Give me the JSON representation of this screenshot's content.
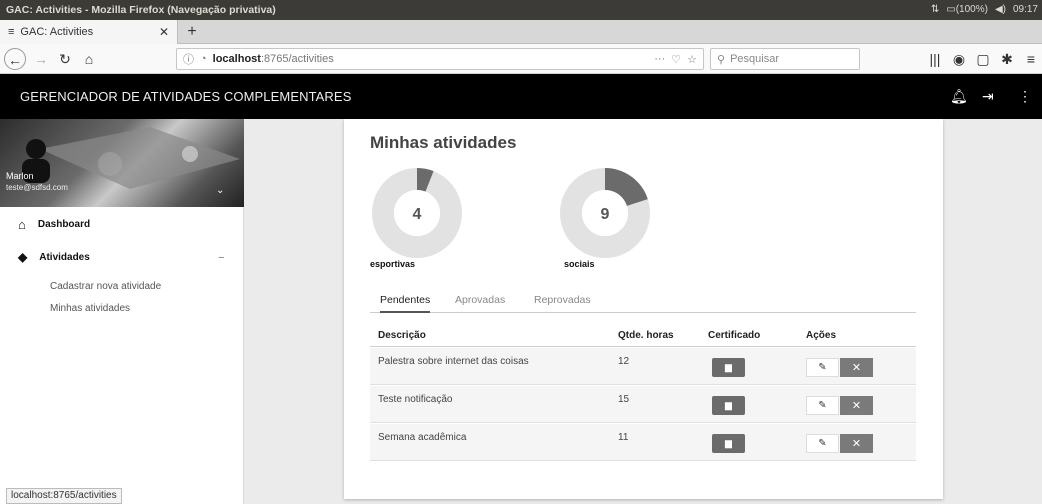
{
  "window": {
    "title": "GAC: Activities - Mozilla Firefox (Navegação privativa)",
    "tray": {
      "battery": "(100%)",
      "time": "09:17"
    }
  },
  "browser": {
    "tab_title": "GAC: Activities",
    "url_host": "localhost",
    "url_path": ":8765/activities",
    "search_placeholder": "Pesquisar",
    "page_actions": "···",
    "status_url": "localhost:8765/activities"
  },
  "app": {
    "name": "GERENCIADOR DE ATIVIDADES COMPLEMENTARES"
  },
  "user": {
    "name": "Marlon",
    "email": "teste@sdfsd.com"
  },
  "sidebar": {
    "dashboard": "Dashboard",
    "atividades": "Atividades",
    "collapse_symbol": "–",
    "sub": [
      "Cadastrar nova atividade",
      "Minhas atividades"
    ]
  },
  "main": {
    "title": "Minhas atividades",
    "charts": [
      {
        "label": "esportivas",
        "count": "4",
        "fraction": 0.06
      },
      {
        "label": "sociais",
        "count": "9",
        "fraction": 0.2
      }
    ],
    "tabs": [
      "Pendentes",
      "Aprovadas",
      "Reprovadas"
    ],
    "columns": [
      "Descrição",
      "Qtde. horas",
      "Certificado",
      "Ações"
    ],
    "rows": [
      {
        "descricao": "Palestra sobre internet das coisas",
        "horas": "12"
      },
      {
        "descricao": "Teste notificação",
        "horas": "15"
      },
      {
        "descricao": "Semana acadêmica",
        "horas": "11"
      }
    ]
  },
  "colors": {
    "topbar": "#000000",
    "donut_track": "#e2e2e2",
    "donut_fill": "#6b6b6b",
    "button_dark": "#6b6b6b"
  }
}
